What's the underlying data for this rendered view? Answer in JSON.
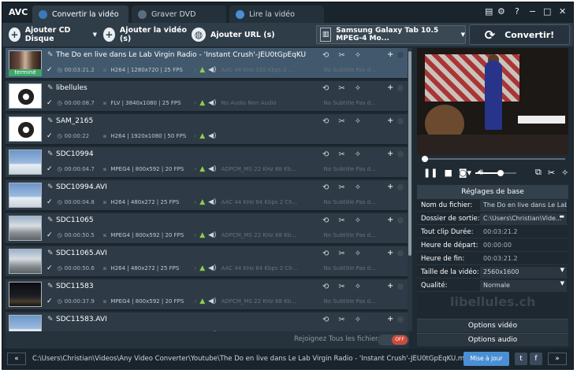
{
  "app": {
    "logo": "AVC"
  },
  "tabs": [
    {
      "label": "Convertir la vidéo"
    },
    {
      "label": "Graver DVD"
    },
    {
      "label": "Lire la vidéo"
    }
  ],
  "toolbar": {
    "add_cd": "Ajouter CD Disque",
    "add_video": "Ajouter la vidéo (s)",
    "add_url": "Ajouter URL (s)",
    "profile": "Samsung Galaxy Tab 10.5 MPEG-4 Mo...",
    "convert": "Convertir!"
  },
  "files": [
    {
      "name": "The Do en live dans Le Lab Virgin Radio - 'Instant Crush'-JEU0tGpEqKU",
      "duration": "00:03:21.2",
      "codec": "H264 | 1280x720 | 25 FPS",
      "audio": "AAC 44 KHz 192 Kbps 2 ...",
      "subtitle": "No Subtitle Pas d...",
      "badge": "terminé"
    },
    {
      "name": "libellules",
      "duration": "00:00:08.7",
      "codec": "FLV | 3840x1080 | 25 FPS",
      "audio": "No Audio Non Audio",
      "subtitle": "No Subtitle Pas d..."
    },
    {
      "name": "SAM_2165",
      "duration": "00:00:22",
      "codec": "H264 | 1920x1080 | 50 FPS",
      "audio": "",
      "subtitle": ""
    },
    {
      "name": "SDC10994",
      "duration": "00:00:04.7",
      "codec": "MPEG4 | 800x592 | 20 FPS",
      "audio": "ADPCM_MS 22 KHz 88 Kb...",
      "subtitle": "No Subtitle Pas d..."
    },
    {
      "name": "SDC10994.AVI",
      "duration": "00:00:04.8",
      "codec": "H264 | 480x272 | 25 FPS",
      "audio": "AAC 44 KHz 64 Kbps 2 Ch...",
      "subtitle": "No Subtitle Pas d..."
    },
    {
      "name": "SDC11065",
      "duration": "00:00:50.5",
      "codec": "MPEG4 | 800x592 | 20 FPS",
      "audio": "ADPCM_MS 22 KHz 88 Kb...",
      "subtitle": "No Subtitle Pas d..."
    },
    {
      "name": "SDC11065.AVI",
      "duration": "00:00:50.6",
      "codec": "H264 | 480x272 | 25 FPS",
      "audio": "AAC 44 KHz 64 Kbps 2 Ch...",
      "subtitle": "No Subtitle Pas d..."
    },
    {
      "name": "SDC11583",
      "duration": "00:00:37.9",
      "codec": "MPEG4 | 800x592 | 20 FPS",
      "audio": "ADPCM_MS 22 KHz 88 Kb...",
      "subtitle": "No Subtitle Pas d..."
    },
    {
      "name": "SDC11583.AVI",
      "duration": "",
      "codec": "",
      "audio": "",
      "subtitle": ""
    }
  ],
  "join": {
    "label": "Rejoignez Tous les fichiers",
    "toggle": "OFF"
  },
  "settings": {
    "header": "Réglages de base",
    "rows": [
      {
        "label": "Nom du fichier:",
        "value": "The Do en live dans Le Lab ..."
      },
      {
        "label": "Dossier de sortie:",
        "value": "C:\\Users\\Christian\\Vide..."
      },
      {
        "label": "Tout clip Durée:",
        "value": "00:03:21.2"
      },
      {
        "label": "Heure de départ:",
        "value": "00:00:00"
      },
      {
        "label": "Heure de fin:",
        "value": "00:03:21.2"
      },
      {
        "label": "Taille de la vidéo:",
        "value": "2560x1600"
      },
      {
        "label": "Qualité:",
        "value": "Normale"
      }
    ],
    "watermark": "libellules.ch",
    "video_options": "Options vidéo",
    "audio_options": "Options audio"
  },
  "status": {
    "path": "C:\\Users\\Christian\\Videos\\Any Video Converter\\Youtube\\The Do en live dans Le Lab Virgin Radio - 'Instant Crush'-JEU0tGpEqKU.mp4",
    "update": "Mise à jour",
    "nav_left": "«",
    "nav_right": "»"
  },
  "player": {
    "progress": 0.0,
    "volume": 0.55
  },
  "icons": [
    "film-icon",
    "gear-icon",
    "help-icon",
    "minimize-icon",
    "maximize-icon",
    "close-icon",
    "cd-add-icon",
    "video-add-icon",
    "globe-icon",
    "refresh-icon",
    "pencil-icon",
    "check-icon",
    "clock-icon",
    "android-icon",
    "speaker-icon",
    "scissors-icon",
    "effects-icon",
    "plus-icon"
  ]
}
